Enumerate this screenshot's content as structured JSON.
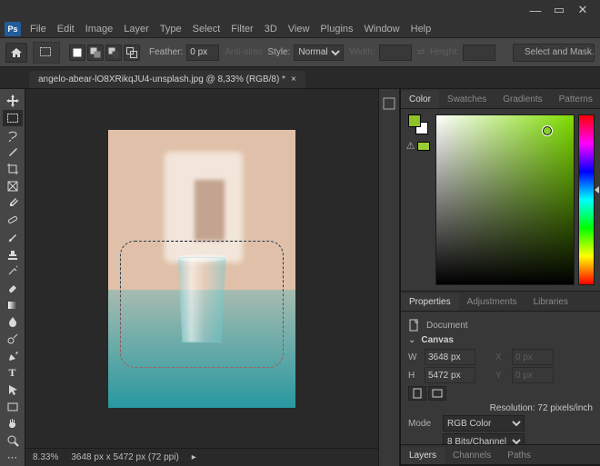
{
  "window": {
    "btn_min": "—",
    "btn_max": "▭",
    "btn_close": "✕"
  },
  "menu": [
    "File",
    "Edit",
    "Image",
    "Layer",
    "Type",
    "Select",
    "Filter",
    "3D",
    "View",
    "Plugins",
    "Window",
    "Help"
  ],
  "options": {
    "feather_label": "Feather:",
    "feather_value": "0 px",
    "antialias_label": "Anti-alias",
    "style_label": "Style:",
    "style_value": "Normal",
    "width_label": "Width:",
    "height_label": "Height:",
    "select_mask": "Select and Mask…"
  },
  "document": {
    "tab_title": "angelo-abear-lO8XRikqJU4-unsplash.jpg @ 8,33% (RGB/8) *",
    "zoom_display": "8.33%",
    "doc_info": "3648 px x 5472 px (72 ppi)"
  },
  "statusbar": {
    "zoom": "8.33%"
  },
  "color_panel": {
    "tabs": [
      "Color",
      "Swatches",
      "Gradients",
      "Patterns"
    ],
    "warn_glyph": "⚠"
  },
  "properties_panel": {
    "tabs": [
      "Properties",
      "Adjustments",
      "Libraries"
    ],
    "doc_label": "Document",
    "section_canvas": "Canvas",
    "w_label": "W",
    "w_value": "3648 px",
    "h_label": "H",
    "h_value": "5472 px",
    "x_label": "X",
    "x_value": "0 px",
    "y_label": "Y",
    "y_value": "0 px",
    "resolution": "Resolution: 72 pixels/inch",
    "mode_label": "Mode",
    "mode_value": "RGB Color",
    "depth_value": "8 Bits/Channel"
  },
  "layers_panel": {
    "tabs": [
      "Layers",
      "Channels",
      "Paths"
    ]
  },
  "tools": [
    "move-tool",
    "rectangular-marquee-tool",
    "lasso-tool",
    "object-selection-tool",
    "crop-tool",
    "frame-tool",
    "eyedropper-tool",
    "healing-brush-tool",
    "brush-tool",
    "clone-stamp-tool",
    "history-brush-tool",
    "eraser-tool",
    "gradient-tool",
    "blur-tool",
    "dodge-tool",
    "pen-tool",
    "type-tool",
    "path-selection-tool",
    "rectangle-tool",
    "hand-tool",
    "zoom-tool",
    "edit-toolbar"
  ],
  "colors": {
    "foreground": "#8fc226",
    "background": "#ffffff"
  }
}
